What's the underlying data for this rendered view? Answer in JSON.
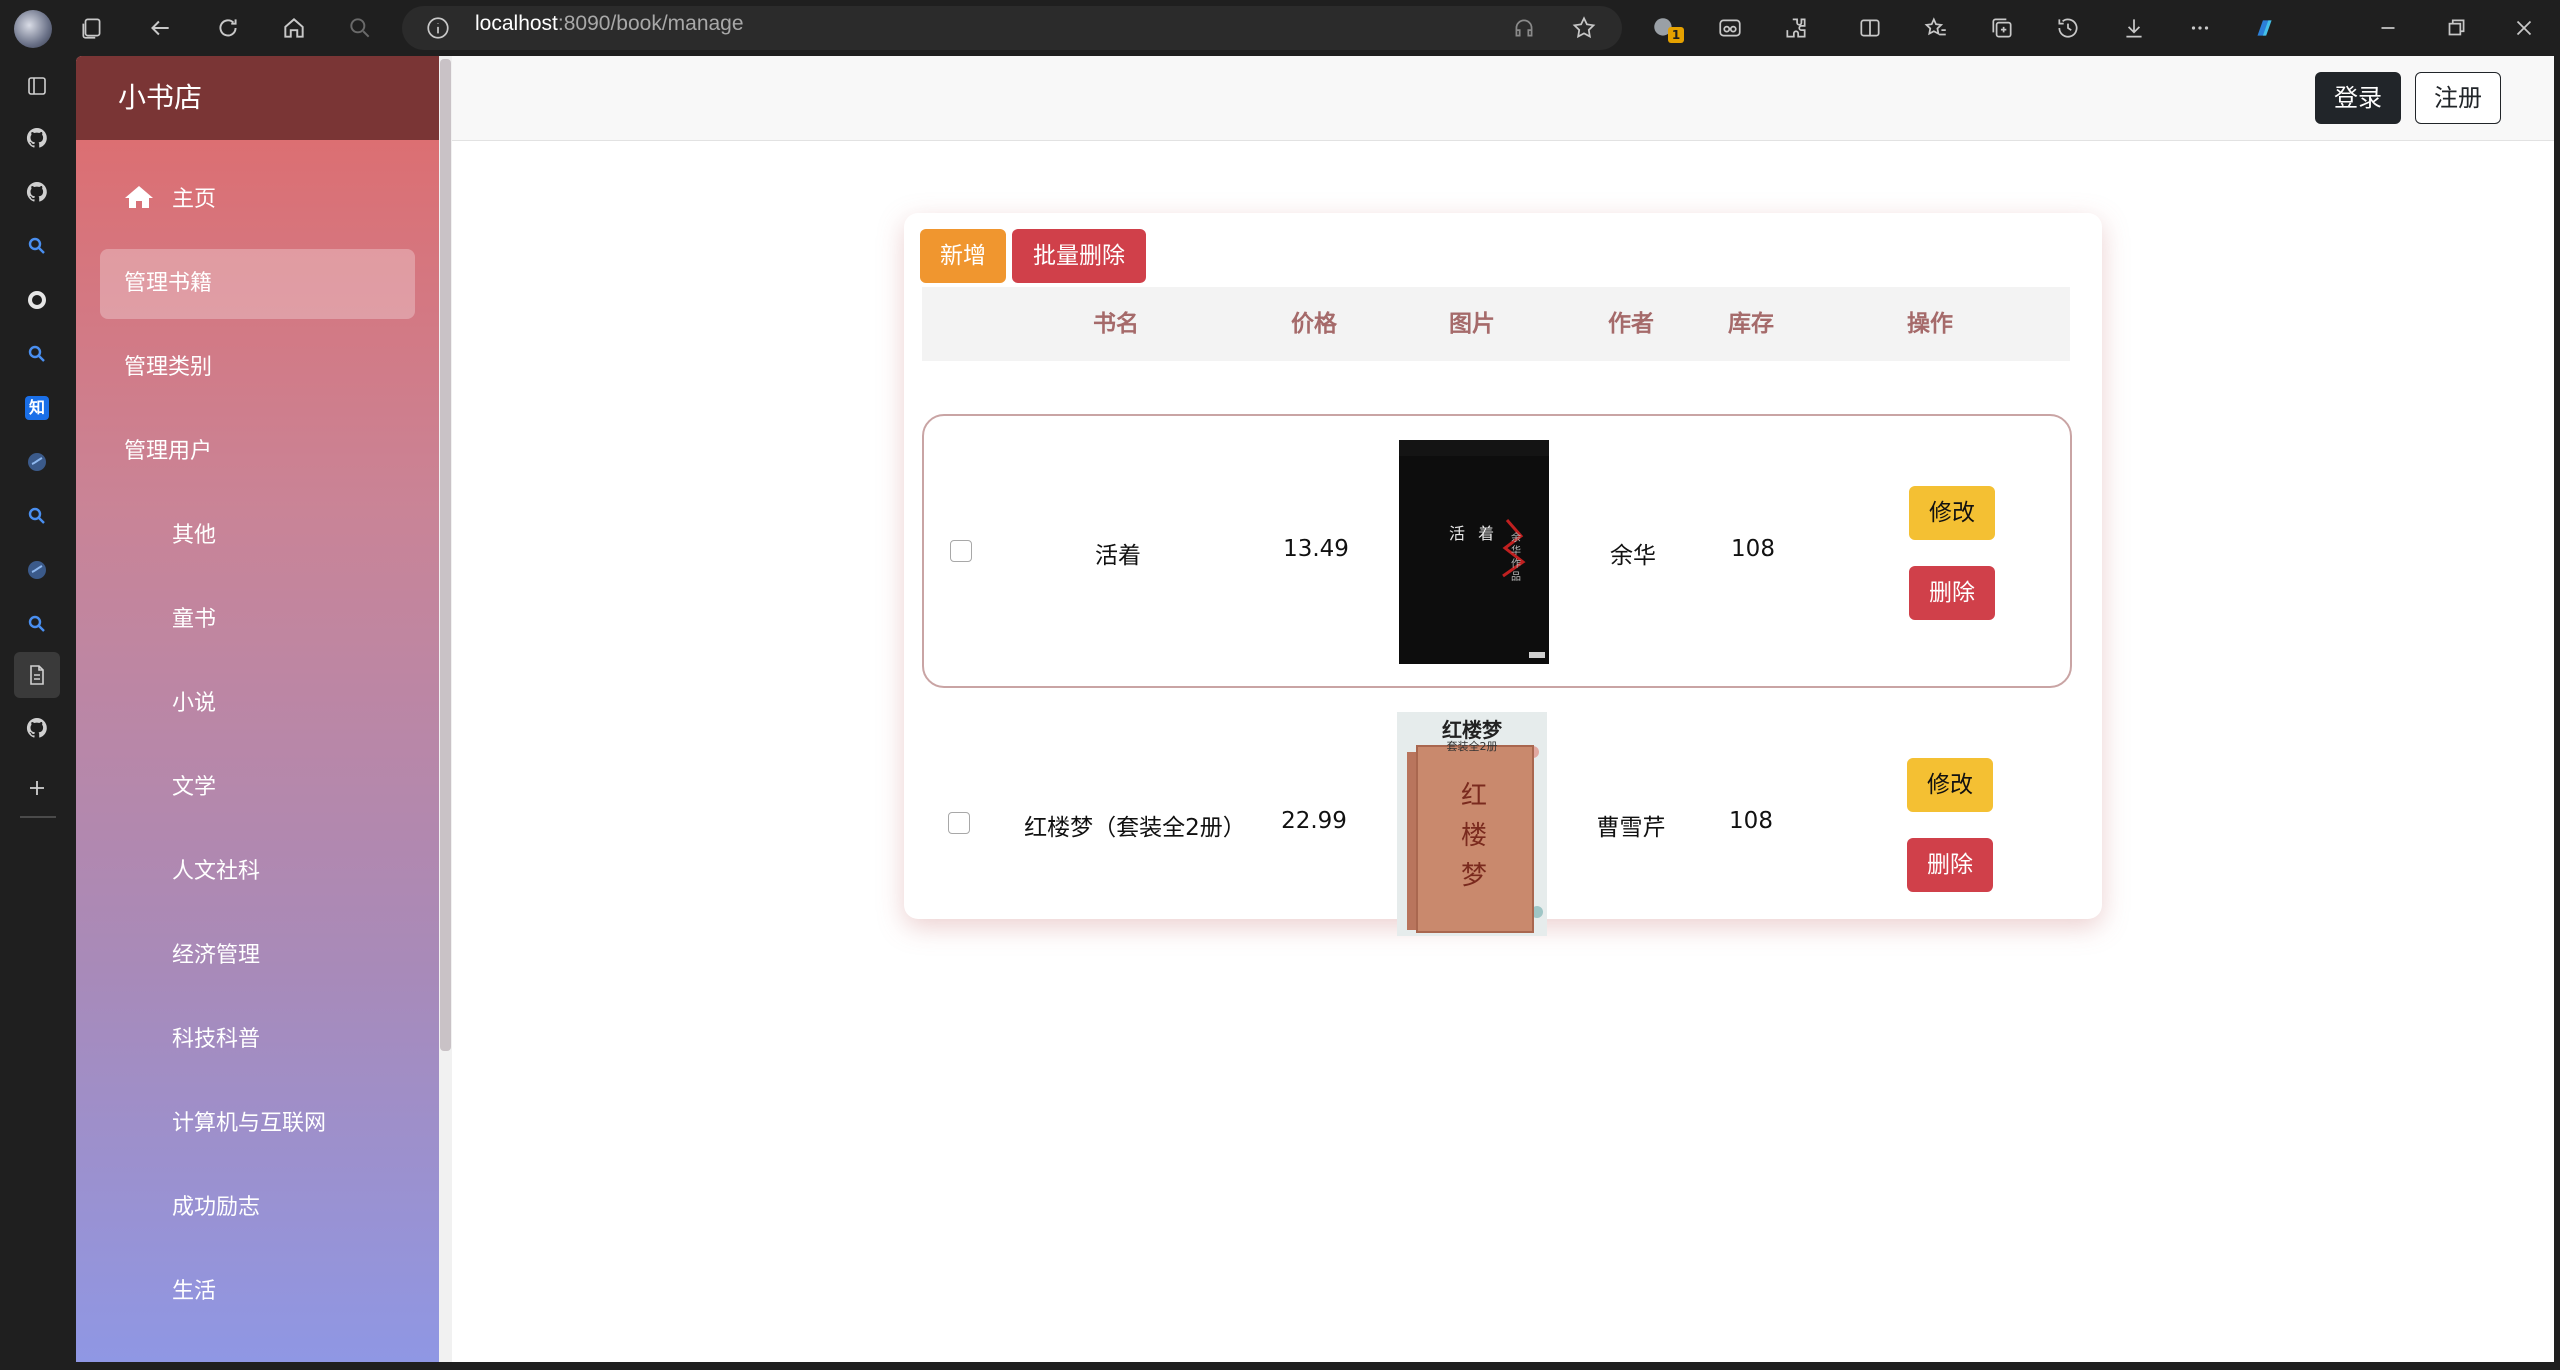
{
  "browser": {
    "url_host": "localhost",
    "url_rest": ":8090/book/manage",
    "badge_count": "1",
    "rail_icons": [
      "collections-icon",
      "github-icon",
      "github-icon",
      "search-icon",
      "github-alt-icon",
      "search-icon",
      "zhihu-icon",
      "app-icon",
      "search-icon",
      "app-icon",
      "search-icon",
      "document-icon",
      "github-icon",
      "add-icon"
    ],
    "zhihu_label": "知"
  },
  "sidebar": {
    "brand": "小书店",
    "items": [
      {
        "label": "主页",
        "level": "top",
        "icon": "home-icon"
      },
      {
        "label": "管理书籍",
        "level": "top",
        "active": true
      },
      {
        "label": "管理类别",
        "level": "top"
      },
      {
        "label": "管理用户",
        "level": "top"
      },
      {
        "label": "其他",
        "level": "sub"
      },
      {
        "label": "童书",
        "level": "sub"
      },
      {
        "label": "小说",
        "level": "sub"
      },
      {
        "label": "文学",
        "level": "sub"
      },
      {
        "label": "人文社科",
        "level": "sub"
      },
      {
        "label": "经济管理",
        "level": "sub"
      },
      {
        "label": "科技科普",
        "level": "sub"
      },
      {
        "label": "计算机与互联网",
        "level": "sub"
      },
      {
        "label": "成功励志",
        "level": "sub"
      },
      {
        "label": "生活",
        "level": "sub"
      }
    ]
  },
  "header": {
    "login_label": "登录",
    "register_label": "注册"
  },
  "toolbar": {
    "add_label": "新增",
    "batch_delete_label": "批量删除"
  },
  "table": {
    "columns": [
      "书名",
      "价格",
      "图片",
      "作者",
      "库存",
      "操作"
    ],
    "rows": [
      {
        "title": "活着",
        "price": "13.49",
        "author": "余华",
        "stock": "108",
        "edit_label": "修改",
        "delete_label": "删除",
        "cover_text": "活 着",
        "cover_sub": "余华作品",
        "selected": true
      },
      {
        "title": "红楼梦（套装全2册）",
        "price": "22.99",
        "author": "曹雪芹",
        "stock": "108",
        "edit_label": "修改",
        "delete_label": "删除",
        "cover_text": "红楼梦",
        "cover_sub": "套装全2册",
        "selected": false
      }
    ]
  },
  "colors": {
    "brand_bar": "#7a3535",
    "header_text": "#a56a6a",
    "add_button": "#f0962f",
    "delete_button": "#d0404a",
    "edit_button": "#f4c033"
  }
}
